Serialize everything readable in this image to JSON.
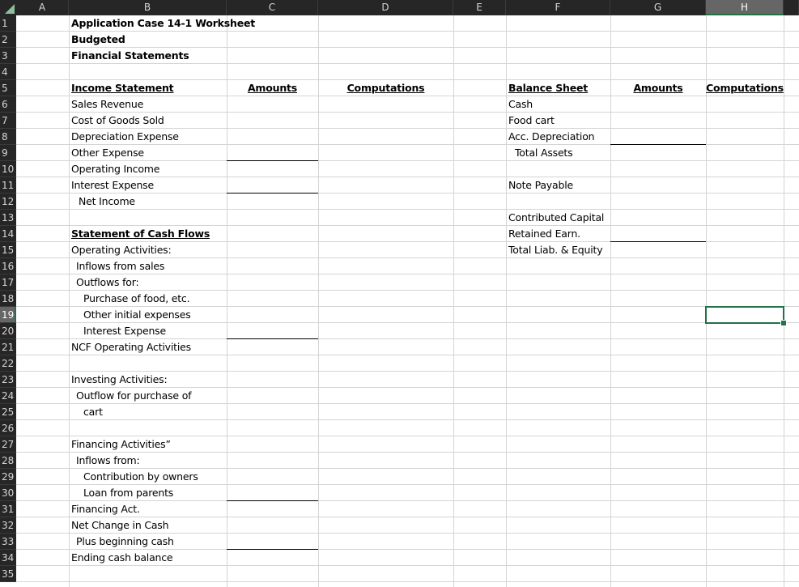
{
  "columns": [
    "A",
    "B",
    "C",
    "D",
    "E",
    "F",
    "G",
    "H"
  ],
  "selected_column": "H",
  "selected_row": 19,
  "rows": [
    1,
    2,
    3,
    4,
    5,
    6,
    7,
    8,
    9,
    10,
    11,
    12,
    13,
    14,
    15,
    16,
    17,
    18,
    19,
    20,
    21,
    22,
    23,
    24,
    25,
    26,
    27,
    28,
    29,
    30,
    31,
    32,
    33,
    34,
    35
  ],
  "header": {
    "title": "Application Case 14-1 Worksheet",
    "subtitle1": "Budgeted",
    "subtitle2": "Financial Statements"
  },
  "income_statement": {
    "heading": "Income Statement",
    "amounts_label": "Amounts",
    "computations_label": "Computations",
    "items": [
      "Sales Revenue",
      "Cost of Goods Sold",
      "Depreciation Expense",
      "Other Expense",
      "Operating Income",
      "Interest Expense",
      "Net Income"
    ]
  },
  "cash_flows": {
    "heading": "Statement of Cash Flows",
    "items": [
      "Operating Activities:",
      "Inflows from sales",
      "Outflows for:",
      "Purchase of food, etc.",
      "Other initial expenses",
      "Interest Expense",
      "NCF Operating Activities",
      "Investing Activities:",
      "Outflow for purchase of",
      "cart",
      "Financing Activities”",
      "Inflows from:",
      "Contribution by owners",
      "Loan from parents",
      "Financing Act.",
      "Net Change in Cash",
      "Plus beginning cash",
      "Ending cash balance"
    ]
  },
  "balance_sheet": {
    "heading": "Balance Sheet",
    "amounts_label": "Amounts",
    "computations_label": "Computations",
    "items": [
      "Cash",
      "Food cart",
      "Acc. Depreciation",
      "Total Assets",
      "Note Payable",
      "Contributed Capital",
      "Retained Earn.",
      "Total Liab. & Equity"
    ]
  },
  "colors": {
    "header_bg": "#262626",
    "selected_header_bg": "#666666",
    "selection_green": "#217346",
    "gridline": "#d4d4d4"
  }
}
